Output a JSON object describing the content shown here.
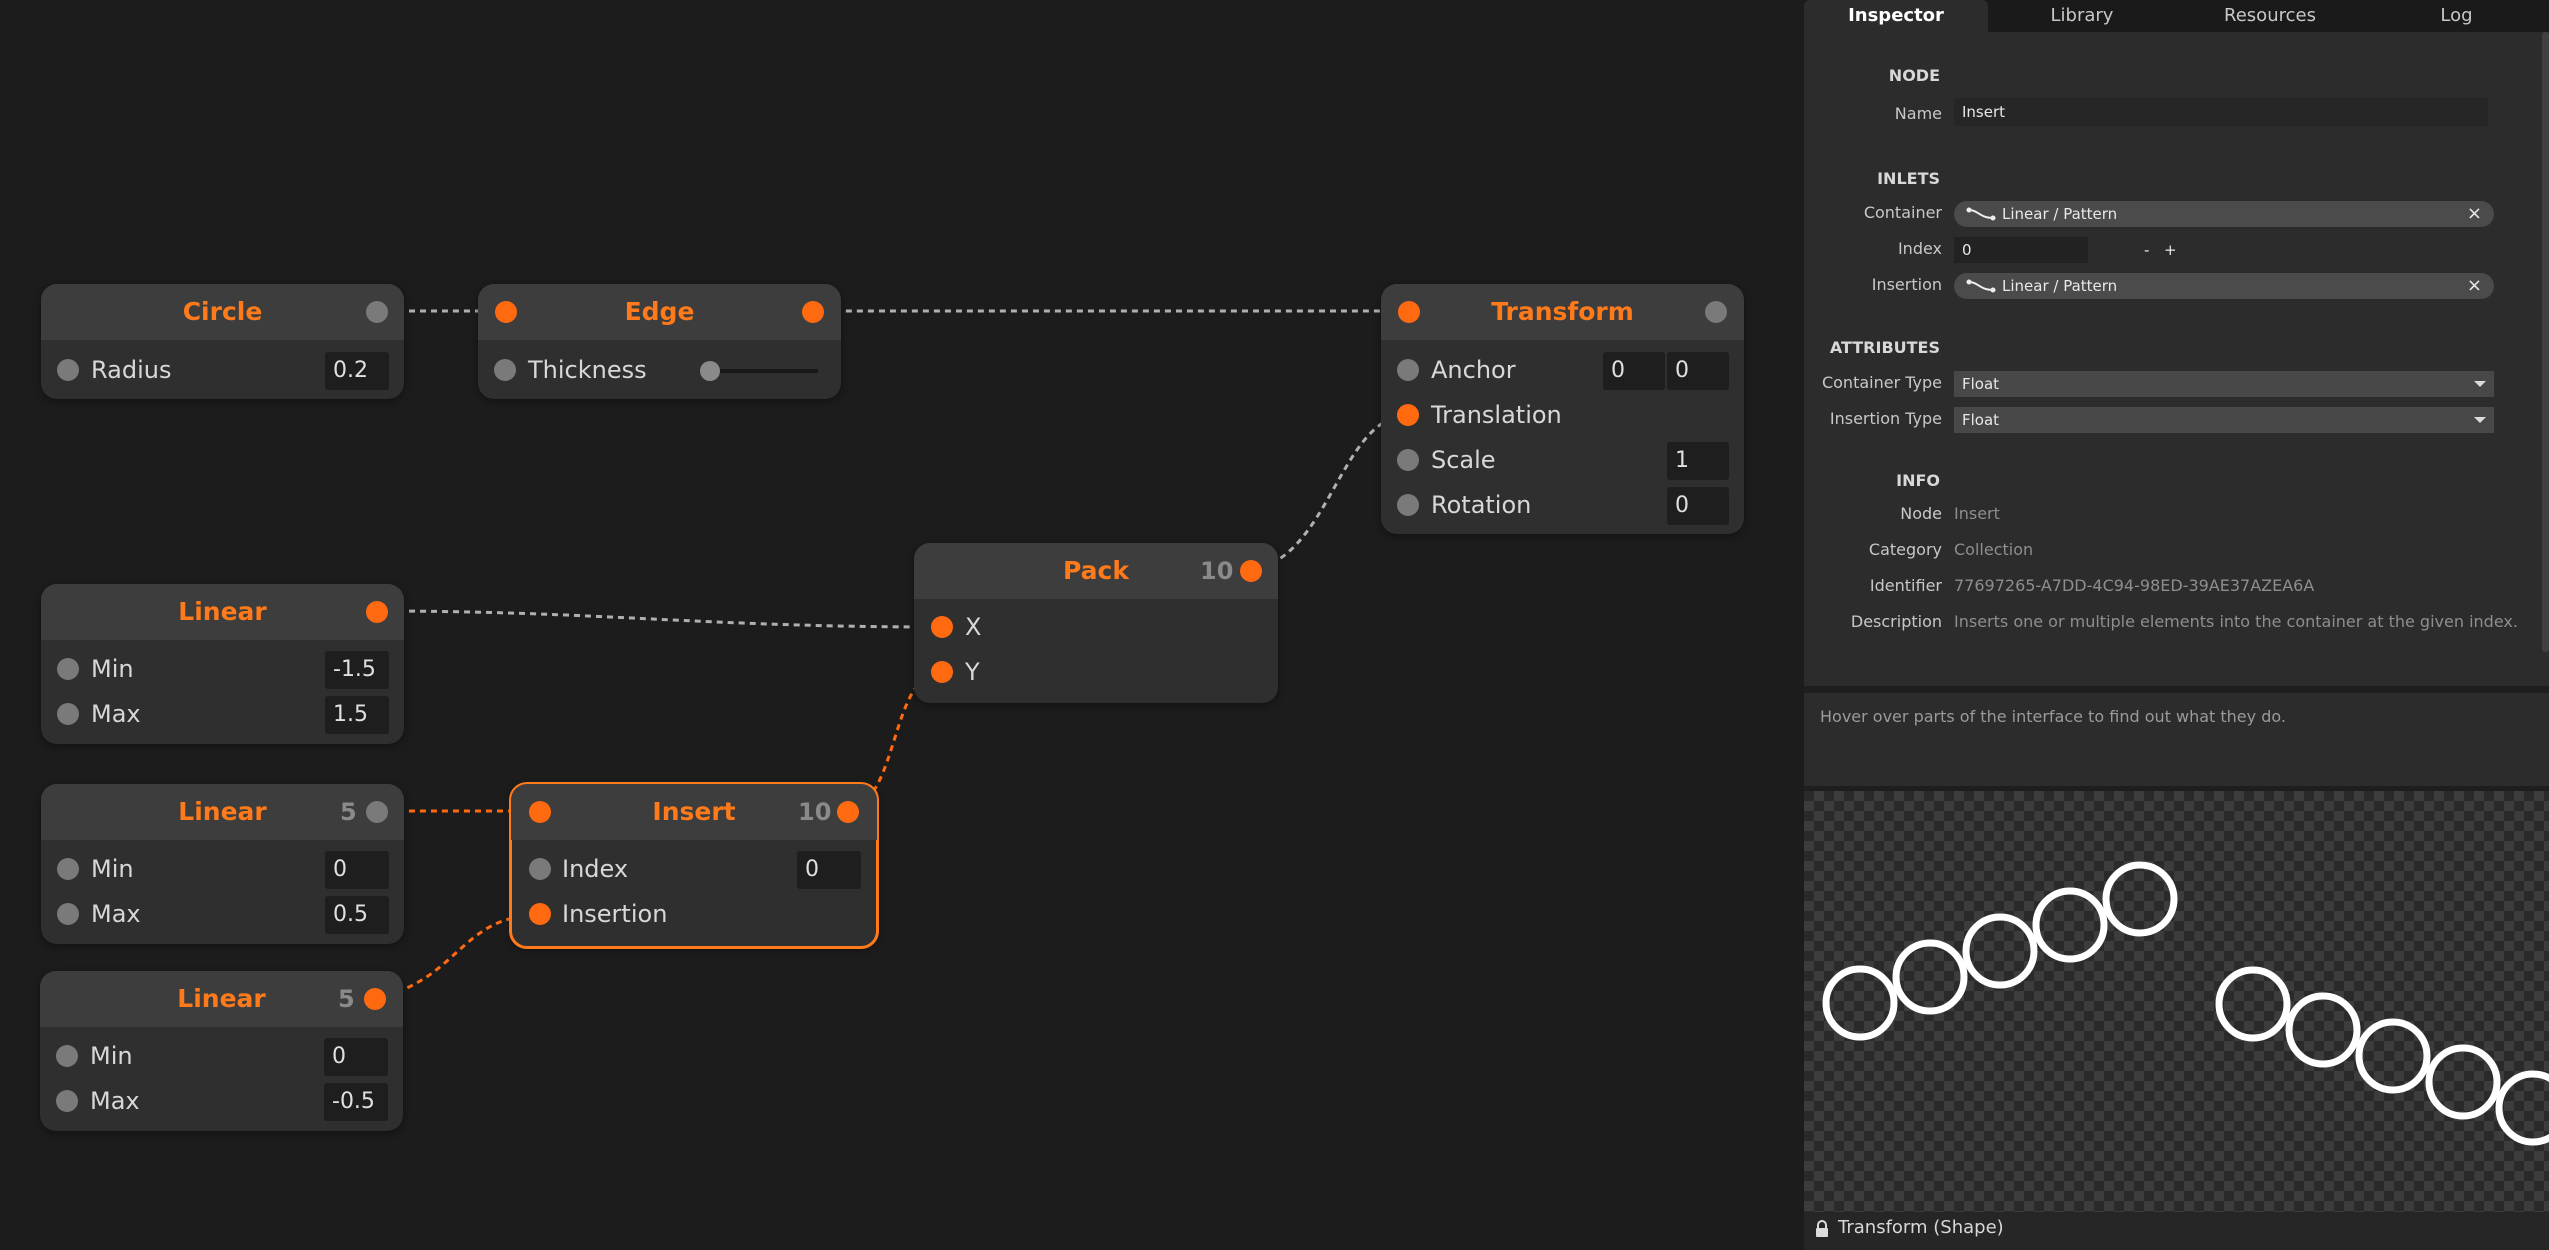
{
  "canvas": {
    "nodes": {
      "circle": {
        "title": "Circle",
        "rows": [
          {
            "label": "Radius",
            "value": "0.2"
          }
        ]
      },
      "edge": {
        "title": "Edge",
        "rows": [
          {
            "label": "Thickness"
          }
        ]
      },
      "transform": {
        "title": "Transform",
        "rows": [
          {
            "label": "Anchor",
            "value": "0",
            "value2": "0"
          },
          {
            "label": "Translation"
          },
          {
            "label": "Scale",
            "value": "1"
          },
          {
            "label": "Rotation",
            "value": "0"
          }
        ]
      },
      "pack": {
        "title": "Pack",
        "count": "10",
        "rows": [
          {
            "label": "X"
          },
          {
            "label": "Y"
          }
        ]
      },
      "linear1": {
        "title": "Linear",
        "rows": [
          {
            "label": "Min",
            "value": "-1.5"
          },
          {
            "label": "Max",
            "value": "1.5"
          }
        ]
      },
      "linear2": {
        "title": "Linear",
        "count": "5",
        "rows": [
          {
            "label": "Min",
            "value": "0"
          },
          {
            "label": "Max",
            "value": "0.5"
          }
        ]
      },
      "insert": {
        "title": "Insert",
        "count": "10",
        "rows": [
          {
            "label": "Index",
            "value": "0"
          },
          {
            "label": "Insertion"
          }
        ]
      },
      "linear3": {
        "title": "Linear",
        "count": "5",
        "rows": [
          {
            "label": "Min",
            "value": "0"
          },
          {
            "label": "Max",
            "value": "-0.5"
          }
        ]
      }
    },
    "colors": {
      "accent": "#ff7a1a",
      "port_off": "#7a7a7a",
      "wire": "#b0b0b0"
    }
  },
  "panel": {
    "tabs": [
      {
        "label": "Inspector"
      },
      {
        "label": "Library"
      },
      {
        "label": "Resources"
      },
      {
        "label": "Log"
      }
    ],
    "inspector": {
      "node_section": "NODE",
      "name_label": "Name",
      "name_value": "Insert",
      "inlets_section": "INLETS",
      "container_label": "Container",
      "container_value": "Linear / Pattern",
      "index_label": "Index",
      "index_value": "0",
      "index_minus": "-",
      "index_plus": "+",
      "insertion_label": "Insertion",
      "insertion_value": "Linear / Pattern",
      "clear_glyph": "×",
      "attributes_section": "ATTRIBUTES",
      "container_type_label": "Container Type",
      "container_type_value": "Float",
      "insertion_type_label": "Insertion Type",
      "insertion_type_value": "Float",
      "info_section": "INFO",
      "info_node_label": "Node",
      "info_node_value": "Insert",
      "info_category_label": "Category",
      "info_category_value": "Collection",
      "info_identifier_label": "Identifier",
      "info_identifier_value": "77697265-A7DD-4C94-98ED-39AE37AZEA6A",
      "info_description_label": "Description",
      "info_description_value": "Inserts one or multiple elements into the container at the given index."
    },
    "hint": "Hover over parts of the interface to find out what they do.",
    "preview": {
      "circles": 10
    },
    "status": {
      "icon": "lock-icon",
      "label": "Transform (Shape)"
    }
  }
}
